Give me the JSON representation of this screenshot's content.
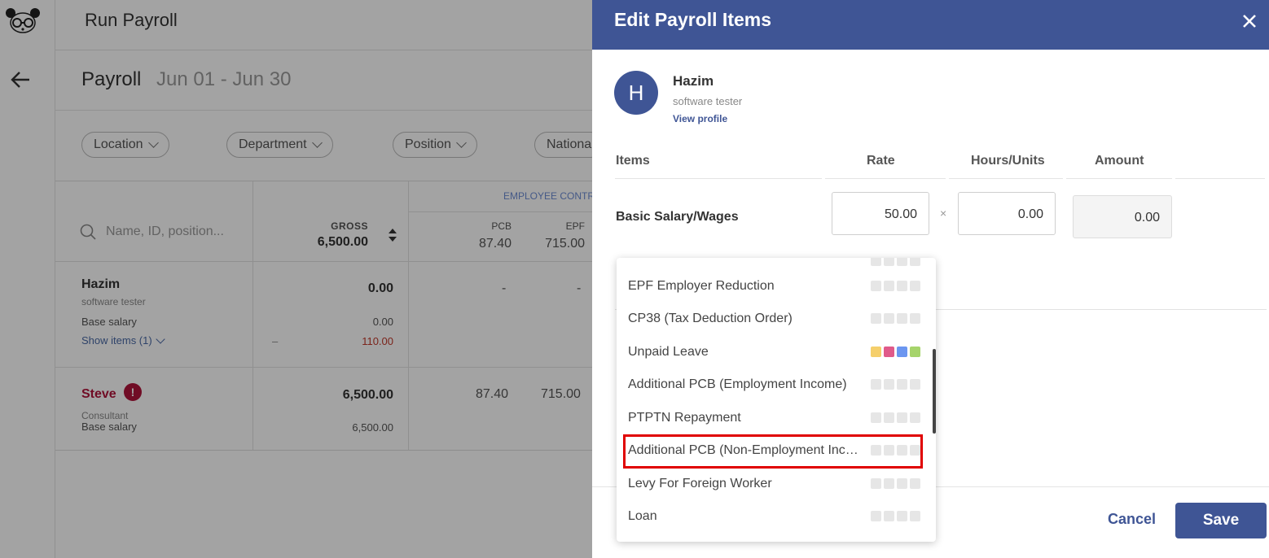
{
  "app": {
    "page_title": "Run Payroll",
    "payroll_label": "Payroll",
    "period": "Jun 01 - Jun 30"
  },
  "filters": [
    "Location",
    "Department",
    "Position",
    "Nationa"
  ],
  "table": {
    "search_placeholder": "Name, ID, position...",
    "gross_label": "GROSS",
    "gross_total": "6,500.00",
    "contrib_header": "EMPLOYEE CONTR",
    "pcb_label": "PCB",
    "pcb_total": "87.40",
    "epf_label": "EPF",
    "epf_total": "715.00",
    "rows": [
      {
        "name": "Hazim",
        "role": "software tester",
        "gross": "0.00",
        "pcb": "-",
        "epf": "-",
        "base_label": "Base salary",
        "base_value": "0.00",
        "show_items": "Show items (1)",
        "dash": "–",
        "extra_value": "110.00"
      },
      {
        "name": "Steve",
        "role": "Consultant",
        "gross": "6,500.00",
        "pcb": "87.40",
        "epf": "715.00",
        "base_label": "Base salary",
        "base_value": "6,500.00",
        "alert": "!"
      }
    ]
  },
  "drawer": {
    "title": "Edit Payroll Items",
    "close_icon": "close-icon",
    "employee": {
      "initial": "H",
      "name": "Hazim",
      "role": "software tester",
      "profile_link": "View profile"
    },
    "columns": {
      "items": "Items",
      "rate": "Rate",
      "hours": "Hours/Units",
      "amount": "Amount"
    },
    "basic_row": {
      "label": "Basic Salary/Wages",
      "rate": "50.00",
      "times": "×",
      "hours": "0.00",
      "amount": "0.00"
    },
    "cancel": "Cancel",
    "save": "Save"
  },
  "dropdown": {
    "items": [
      {
        "label": "EPF Employer Reduction",
        "colored": false
      },
      {
        "label": "CP38 (Tax Deduction Order)",
        "colored": false
      },
      {
        "label": "Unpaid Leave",
        "colored": true
      },
      {
        "label": "Additional PCB (Employment Income)",
        "colored": false
      },
      {
        "label": "PTPTN Repayment",
        "colored": false
      },
      {
        "label": "Additional PCB (Non-Employment Income)",
        "colored": false,
        "highlighted": true
      },
      {
        "label": "Levy For Foreign Worker",
        "colored": false
      },
      {
        "label": "Loan",
        "colored": false
      }
    ],
    "swatch_colors": [
      "#f5cf6b",
      "#e05a8a",
      "#6b96f0",
      "#a6d46b"
    ],
    "swatch_gray": "#e6e6e6"
  },
  "colors": {
    "brand": "#3f5595",
    "alert": "#b0143a",
    "highlight": "#e00000"
  }
}
